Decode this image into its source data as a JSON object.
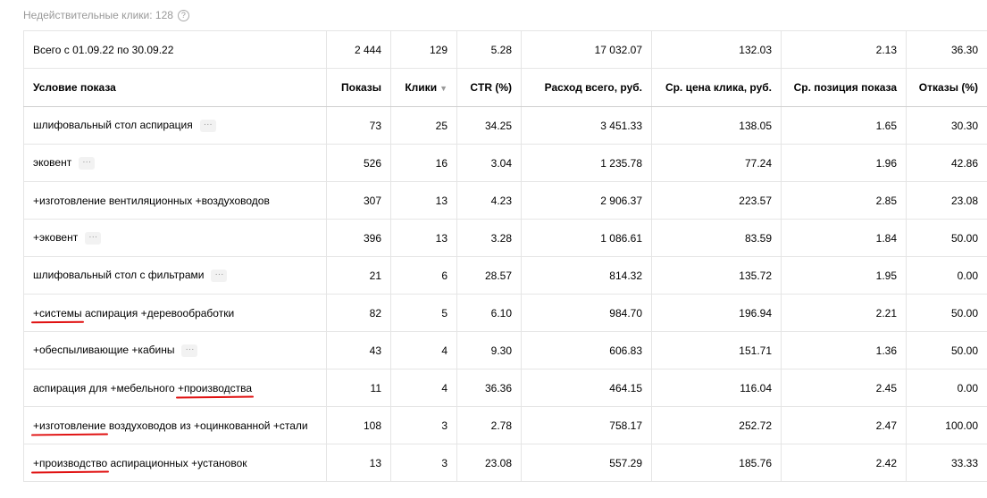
{
  "invalid_clicks": {
    "label": "Недействительные клики: 128"
  },
  "total": {
    "label": "Всего с 01.09.22 по 30.09.22",
    "values": [
      "2 444",
      "129",
      "5.28",
      "17 032.07",
      "132.03",
      "2.13",
      "36.30"
    ]
  },
  "headers": [
    "Условие показа",
    "Показы",
    "Клики",
    "CTR (%)",
    "Расход всего, руб.",
    "Ср. цена клика, руб.",
    "Ср. позиция показа",
    "Отказы (%)"
  ],
  "rows": [
    {
      "name": "шлифовальный стол аспирация",
      "more": "···",
      "values": [
        "73",
        "25",
        "34.25",
        "3 451.33",
        "138.05",
        "1.65",
        "30.30"
      ]
    },
    {
      "name": "эковент",
      "more": "···",
      "values": [
        "526",
        "16",
        "3.04",
        "1 235.78",
        "77.24",
        "1.96",
        "42.86"
      ]
    },
    {
      "name": "+изготовление вентиляционных +воздуховодов",
      "values": [
        "307",
        "13",
        "4.23",
        "2 906.37",
        "223.57",
        "2.85",
        "23.08"
      ]
    },
    {
      "name": "+эковент",
      "more": "···",
      "values": [
        "396",
        "13",
        "3.28",
        "1 086.61",
        "83.59",
        "1.84",
        "50.00"
      ]
    },
    {
      "name": "шлифовальный стол с фильтрами",
      "more": "···",
      "values": [
        "21",
        "6",
        "28.57",
        "814.32",
        "135.72",
        "1.95",
        "0.00"
      ]
    },
    {
      "name": "+системы аспирация +деревообработки",
      "values": [
        "82",
        "5",
        "6.10",
        "984.70",
        "196.94",
        "2.21",
        "50.00"
      ]
    },
    {
      "name": "+обеспыливающие +кабины",
      "more": "···",
      "values": [
        "43",
        "4",
        "9.30",
        "606.83",
        "151.71",
        "1.36",
        "50.00"
      ]
    },
    {
      "name": "аспирация для +мебельного +производства",
      "values": [
        "11",
        "4",
        "36.36",
        "464.15",
        "116.04",
        "2.45",
        "0.00"
      ]
    },
    {
      "name": "+изготовление воздуховодов из +оцинкованной +стали",
      "values": [
        "108",
        "3",
        "2.78",
        "758.17",
        "252.72",
        "2.47",
        "100.00"
      ]
    },
    {
      "name": "+производство аспирационных +установок",
      "values": [
        "13",
        "3",
        "23.08",
        "557.29",
        "185.76",
        "2.42",
        "33.33"
      ]
    }
  ],
  "colors": {
    "underline": "#e01010",
    "muted": "#999999",
    "border": "#e5e5e5"
  }
}
